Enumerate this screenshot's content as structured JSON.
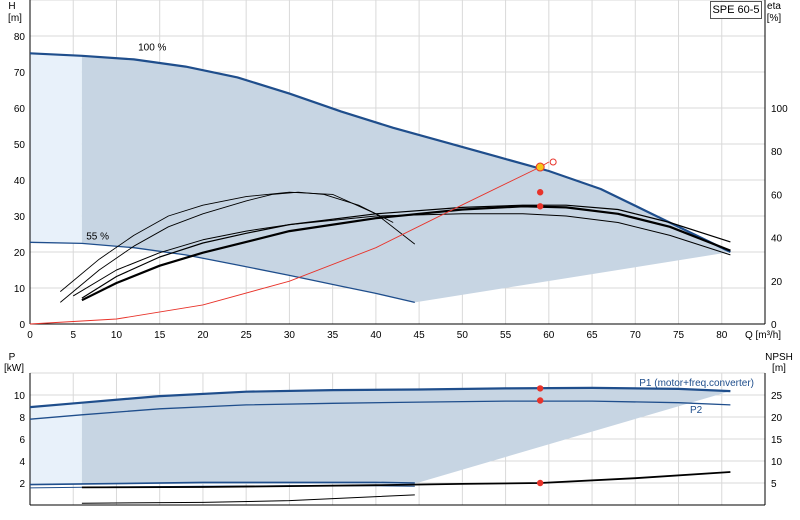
{
  "model_label": "SPE 60-5",
  "colors": {
    "curve_blue": "#1f4e8c",
    "shade": "#c7d5e3",
    "light_shade": "#e8f1fa",
    "grid": "#d9d9d9",
    "red": "#e8332a",
    "duty_point": "#f5c518"
  },
  "chart_data": [
    {
      "type": "line",
      "panel": "head_efficiency",
      "xlabel": "Q [m³/h]",
      "ylabel": "H\n[m]",
      "ylabel_parts": [
        "H",
        "[m]"
      ],
      "y2label_parts": [
        "eta",
        "[%]"
      ],
      "xlim": [
        0,
        85
      ],
      "ylim": [
        0,
        90
      ],
      "y2lim": [
        0,
        150
      ],
      "x_ticks": [
        0,
        5,
        10,
        15,
        20,
        25,
        30,
        35,
        40,
        45,
        50,
        55,
        60,
        65,
        70,
        75,
        80
      ],
      "y_ticks": [
        0,
        10,
        20,
        30,
        40,
        50,
        60,
        70,
        80
      ],
      "y2_ticks": [
        0,
        20,
        40,
        60,
        80,
        100
      ],
      "grid": true,
      "annotations": [
        {
          "text": "100 %",
          "x": 12.5,
          "y": 76
        },
        {
          "text": "55 %",
          "x": 6.5,
          "y": 23.5
        }
      ],
      "series": [
        {
          "id": "head_100",
          "axis": "y",
          "x": [
            0,
            6,
            12,
            18,
            24,
            30,
            36,
            42,
            48,
            54,
            60,
            66,
            72,
            78,
            81
          ],
          "y": [
            75.2,
            74.5,
            73.5,
            71.5,
            68.5,
            64,
            59,
            54.5,
            50.5,
            46.5,
            42.5,
            37.5,
            30.5,
            23.5,
            20
          ]
        },
        {
          "id": "head_55",
          "axis": "y",
          "x": [
            0,
            6,
            12,
            18,
            24,
            30,
            36,
            40,
            44.5
          ],
          "y": [
            22.7,
            22.4,
            21.2,
            19.2,
            16.4,
            13.5,
            10.5,
            8.5,
            6
          ]
        },
        {
          "id": "eta_total",
          "axis": "y2",
          "x": [
            3.5,
            8,
            12,
            16,
            20,
            25,
            30,
            35,
            40,
            44.5
          ],
          "y": [
            15,
            30,
            41,
            50,
            55,
            59,
            61,
            60,
            51,
            37
          ]
        },
        {
          "id": "eta_pump_55",
          "axis": "y2",
          "x": [
            3.5,
            8,
            12,
            16,
            20,
            25,
            28,
            31,
            34,
            38,
            42
          ],
          "y": [
            10,
            25,
            36,
            45,
            51,
            57,
            60,
            61,
            60,
            55,
            47
          ]
        },
        {
          "id": "eta_a",
          "axis": "y2",
          "x": [
            5,
            10,
            15,
            20,
            25,
            30,
            40,
            50,
            57,
            62,
            68,
            74,
            81
          ],
          "y": [
            13,
            25,
            33,
            39,
            43,
            46,
            50,
            51,
            51,
            50,
            47,
            41,
            32
          ]
        },
        {
          "id": "eta_b",
          "axis": "y2",
          "x": [
            6,
            10,
            15,
            20,
            25,
            30,
            40,
            50,
            57,
            62,
            68,
            74,
            81
          ],
          "y": [
            12,
            22,
            31,
            37.5,
            42,
            46,
            51,
            54,
            55,
            55,
            53,
            47,
            38
          ]
        },
        {
          "id": "eta_c_bold",
          "axis": "y2",
          "x": [
            6,
            10,
            15,
            20,
            25,
            30,
            40,
            50,
            57,
            62,
            68,
            74,
            81
          ],
          "y": [
            11,
            19,
            27,
            33,
            38,
            43,
            49,
            53,
            54.5,
            54,
            51,
            45,
            34
          ]
        },
        {
          "id": "system_curve",
          "axis": "y",
          "x": [
            0,
            10,
            20,
            30,
            40,
            50,
            59,
            60
          ],
          "y": [
            0,
            1.4,
            5.3,
            11.9,
            21.2,
            33.1,
            43.6,
            45
          ]
        }
      ],
      "markers": [
        {
          "id": "duty_point",
          "x": 59,
          "y": 43.6,
          "axis": "y",
          "style": "yellow"
        },
        {
          "id": "duty_open",
          "x": 60.5,
          "y": 45,
          "axis": "y",
          "style": "open"
        },
        {
          "id": "eta_pt_1",
          "x": 59,
          "y": 36.6,
          "axis": "y",
          "style": "red"
        },
        {
          "id": "eta_pt_2",
          "x": 59,
          "y": 32.7,
          "axis": "y",
          "style": "red"
        }
      ]
    },
    {
      "type": "line",
      "panel": "power_npsh",
      "xlabel": "",
      "ylabel_parts": [
        "P",
        "[kW]"
      ],
      "y2label_parts": [
        "NPSH",
        "[m]"
      ],
      "xlim": [
        0,
        85
      ],
      "ylim": [
        0,
        12
      ],
      "y2lim": [
        0,
        30
      ],
      "y_ticks": [
        2,
        4,
        6,
        8,
        10
      ],
      "y2_ticks": [
        5,
        10,
        15,
        20,
        25
      ],
      "grid": true,
      "series": [
        {
          "id": "P1_100",
          "name": "P1 (motor+freq.converter)",
          "axis": "y",
          "x": [
            0,
            6,
            15,
            25,
            35,
            45,
            55,
            65,
            75,
            81
          ],
          "y": [
            8.9,
            9.3,
            9.9,
            10.3,
            10.45,
            10.5,
            10.6,
            10.65,
            10.55,
            10.35
          ]
        },
        {
          "id": "P2_100",
          "name": "P2",
          "axis": "y",
          "x": [
            0,
            6,
            15,
            25,
            35,
            45,
            55,
            65,
            75,
            81
          ],
          "y": [
            7.8,
            8.2,
            8.75,
            9.1,
            9.25,
            9.35,
            9.45,
            9.45,
            9.3,
            9.1
          ]
        },
        {
          "id": "P1_55",
          "axis": "y",
          "x": [
            0,
            10,
            20,
            30,
            40,
            44.5
          ],
          "y": [
            1.85,
            1.95,
            2.05,
            2.05,
            2.05,
            2.0
          ]
        },
        {
          "id": "P2_55",
          "axis": "y",
          "x": [
            0,
            10,
            20,
            30,
            40,
            44.5
          ],
          "y": [
            1.55,
            1.65,
            1.7,
            1.75,
            1.75,
            1.7
          ]
        },
        {
          "id": "npsh",
          "axis": "y2",
          "x": [
            6,
            20,
            30,
            40,
            50,
            59,
            70,
            81
          ],
          "y": [
            4.0,
            4.1,
            4.3,
            4.5,
            4.8,
            5.0,
            6.1,
            7.5
          ]
        },
        {
          "id": "npsh_55",
          "axis": "y2",
          "x": [
            6,
            20,
            30,
            44.5
          ],
          "y": [
            0.4,
            0.6,
            1.0,
            2.3
          ]
        }
      ],
      "markers": [
        {
          "id": "p1_pt",
          "x": 59,
          "y": 10.6,
          "axis": "y",
          "style": "red"
        },
        {
          "id": "p2_pt",
          "x": 59,
          "y": 9.5,
          "axis": "y",
          "style": "red"
        },
        {
          "id": "npsh_pt",
          "x": 59,
          "y": 5.0,
          "axis": "y2",
          "style": "red"
        }
      ]
    }
  ]
}
